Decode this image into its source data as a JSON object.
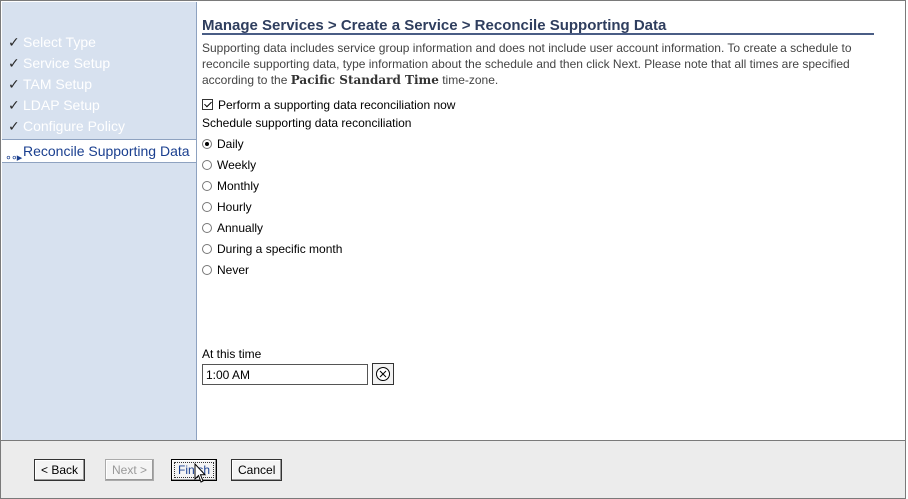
{
  "nav": {
    "completed_steps": [
      {
        "label": "Select Type"
      },
      {
        "label": "Service Setup"
      },
      {
        "label": "TAM Setup"
      },
      {
        "label": "LDAP Setup"
      },
      {
        "label": "Configure Policy"
      }
    ],
    "current_step": {
      "label": "Reconcile Supporting Data"
    }
  },
  "main": {
    "title": "Manage Services > Create a Service > Reconcile Supporting Data",
    "description_pre": "Supporting data includes service group information and does not include user account information. To create a schedule to reconcile supporting data, type information about the schedule and then click Next. Please note that all times are specified according to the ",
    "timezone": "Pacific Standard Time",
    "description_post": " time-zone.",
    "perform_now": {
      "label": "Perform a supporting data reconciliation now",
      "checked": true
    },
    "schedule_heading": "Schedule supporting data reconciliation",
    "schedule_options": [
      {
        "label": "Daily",
        "selected": true
      },
      {
        "label": "Weekly",
        "selected": false
      },
      {
        "label": "Monthly",
        "selected": false
      },
      {
        "label": "Hourly",
        "selected": false
      },
      {
        "label": "Annually",
        "selected": false
      },
      {
        "label": "During a specific month",
        "selected": false
      },
      {
        "label": "Never",
        "selected": false
      }
    ],
    "time_label": "At this time",
    "time_value": "1:00 AM"
  },
  "buttons": {
    "back": "< Back",
    "next": "Next >",
    "finish": "Finish",
    "cancel": "Cancel"
  },
  "colors": {
    "nav_bg": "#d7e1ef",
    "title": "#2f3e5e",
    "current_step": "#1a3f8f"
  }
}
